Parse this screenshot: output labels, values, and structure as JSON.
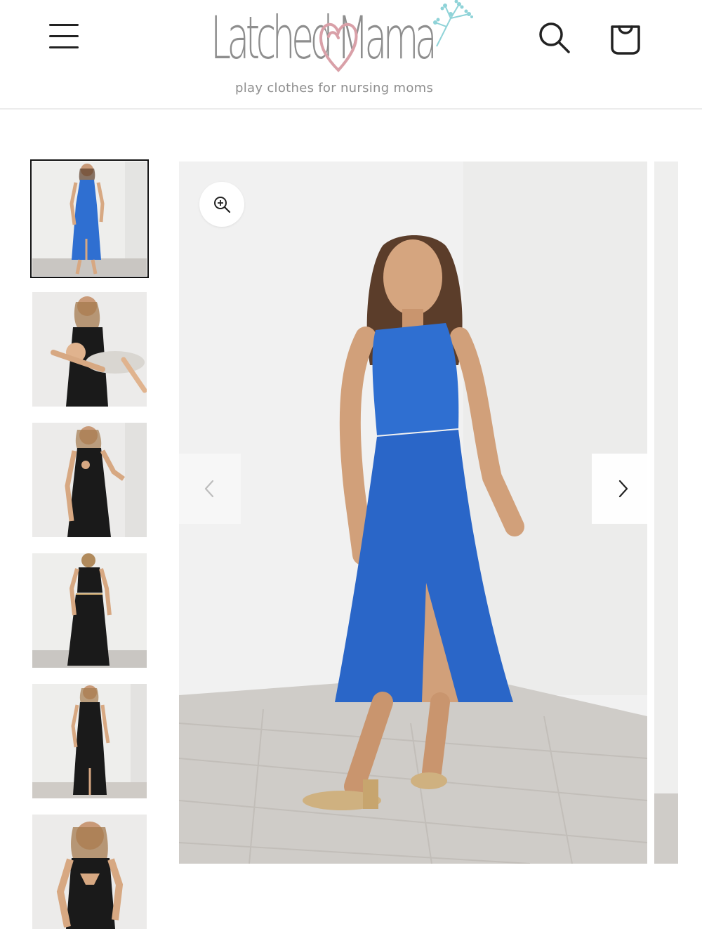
{
  "header": {
    "menu_icon": "hamburger-menu-icon",
    "logo": {
      "wordmark": "Latched Mama",
      "tagline": "play clothes for nursing moms",
      "heart_color": "#d9a0a8",
      "flower_color": "#8fd3d8"
    },
    "search_icon": "search-icon",
    "cart_icon": "shopping-bag-icon"
  },
  "gallery": {
    "thumbnails": [
      {
        "dress_color": "#2f6fd1",
        "pose": "standing",
        "active": true
      },
      {
        "dress_color": "#1a1a1a",
        "pose": "nursing-baby",
        "active": false
      },
      {
        "dress_color": "#1a1a1a",
        "pose": "standing-nursing-access",
        "active": false
      },
      {
        "dress_color": "#1a1a1a",
        "pose": "back-view",
        "active": false
      },
      {
        "dress_color": "#1a1a1a",
        "pose": "standing",
        "active": false
      },
      {
        "dress_color": "#1a1a1a",
        "pose": "close-up-nursing-access",
        "active": false
      }
    ],
    "main_image": {
      "dress_color": "#2f6fd1",
      "zoom_icon": "zoom-in-icon",
      "prev_icon": "chevron-left-icon",
      "next_icon": "chevron-right-icon"
    }
  }
}
